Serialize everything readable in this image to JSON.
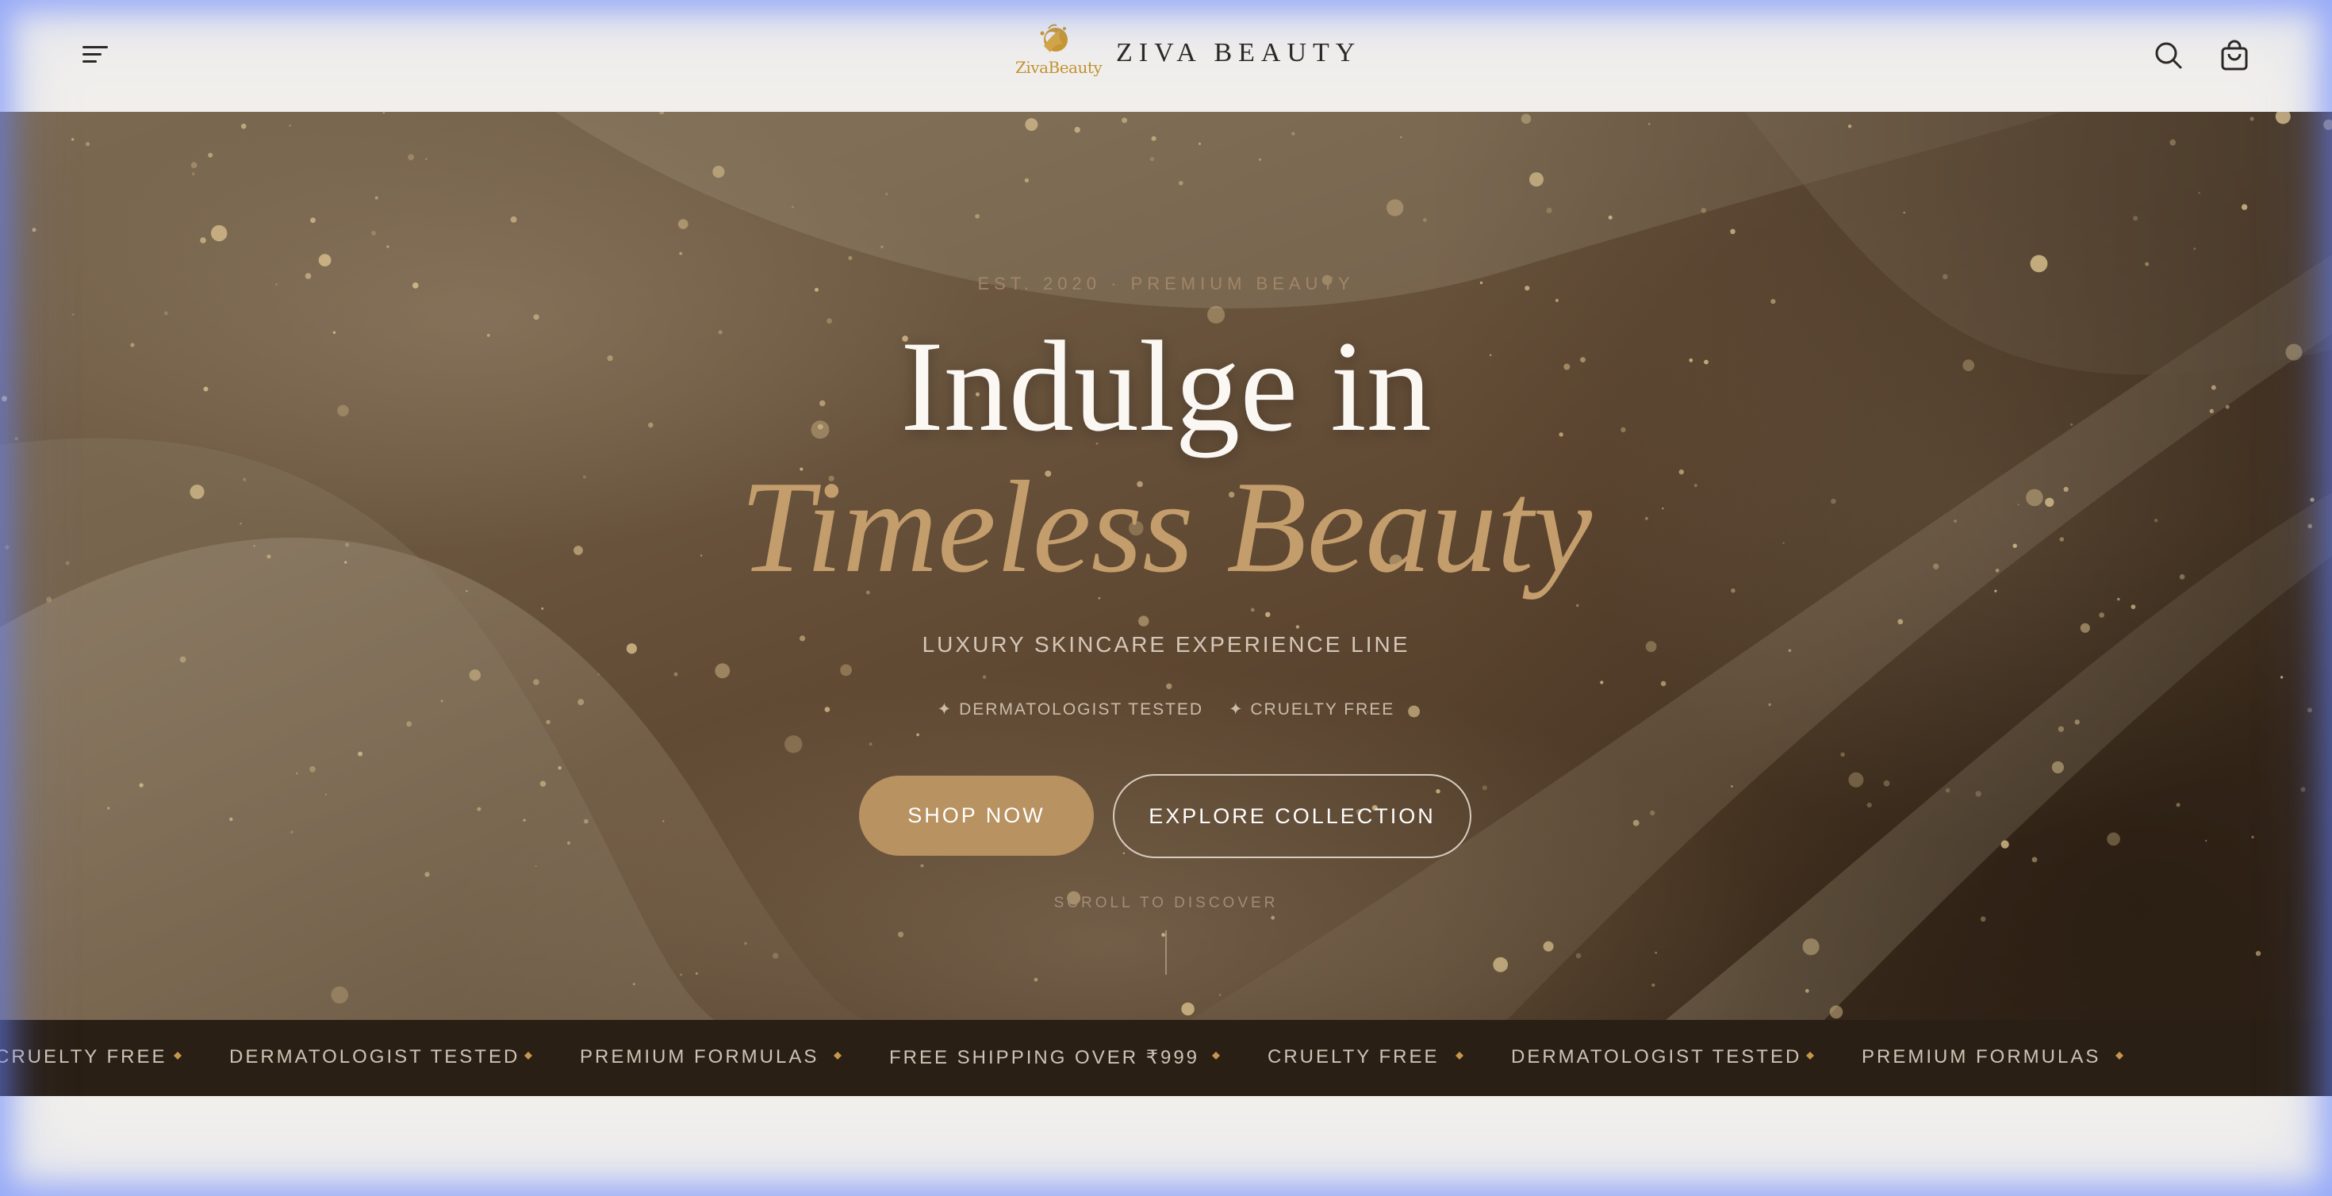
{
  "header": {
    "logo_text": "ZivaBeauty",
    "brand": "ZIVA BEAUTY",
    "menu_icon": "hamburger-menu-icon",
    "search_icon": "search-icon",
    "cart_icon": "shopping-bag-icon"
  },
  "hero": {
    "eyebrow": "EST. 2020 · PREMIUM BEAUTY",
    "title_line1": "Indulge in",
    "title_line2": "Timeless Beauty",
    "subtitle": "LUXURY SKINCARE EXPERIENCE LINE",
    "badge1": "✦ DERMATOLOGIST TESTED",
    "badge2": "✦ CRUELTY FREE",
    "shop_button": "SHOP NOW",
    "explore_button": "EXPLORE COLLECTION",
    "scroll_hint": "SCROLL TO DISCOVER"
  },
  "marquee": {
    "items": [
      "CRUELTY FREE",
      "DERMATOLOGIST TESTED",
      "PREMIUM FORMULAS",
      "FREE SHIPPING OVER ₹999",
      "CRUELTY FREE",
      "DERMATOLOGIST TESTED",
      "PREMIUM FORMULAS"
    ]
  },
  "colors": {
    "accent_gold": "#b89260",
    "title_gold": "#c49d6c",
    "marquee_bg": "#2a1f14",
    "header_bg": "#f1efec"
  }
}
